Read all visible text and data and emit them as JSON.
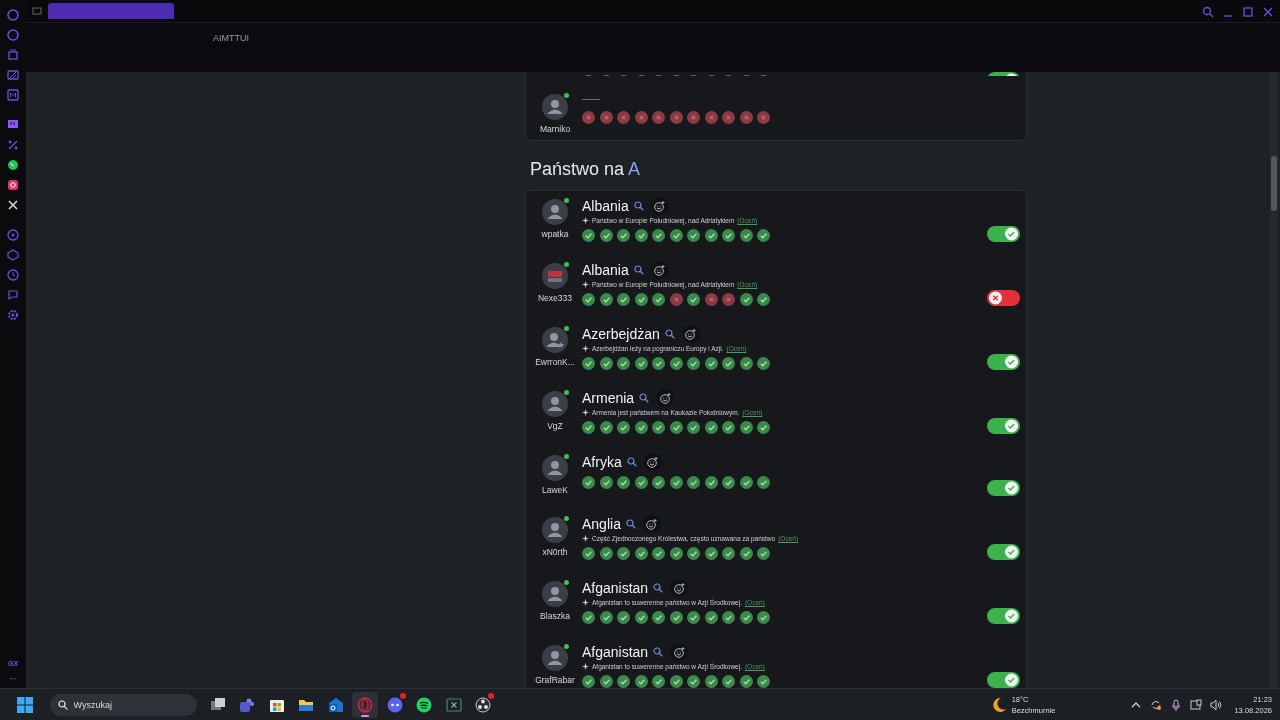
{
  "top_bar": {
    "address_text": "AIMTTUI"
  },
  "sidebar": {
    "footer_label": "GX",
    "more_label": "···"
  },
  "content": [
    {
      "kind": "card",
      "rows": [
        {
          "kind": "cut",
          "votes": [
            true,
            true,
            true,
            true,
            true,
            true,
            true,
            true,
            true,
            true,
            true
          ],
          "accepted": true
        },
        {
          "kind": "answer",
          "player": "Marniko",
          "online": true,
          "avatar": {
            "kind": "default"
          },
          "answer": "——",
          "votes": [
            false,
            false,
            false,
            false,
            false,
            false,
            false,
            false,
            false,
            false,
            false
          ]
        }
      ]
    },
    {
      "kind": "heading",
      "text": "Państwo na",
      "letter": "A"
    },
    {
      "kind": "card",
      "rows": [
        {
          "kind": "answer",
          "player": "wpatka",
          "online": true,
          "avatar": {
            "kind": "default"
          },
          "answer": "Albania",
          "description": "Państwo w Europie Południowej, nad Adriatykiem",
          "rate_link": "(Oceń)",
          "votes": [
            true,
            true,
            true,
            true,
            true,
            true,
            true,
            true,
            true,
            true,
            true
          ],
          "accepted": true
        },
        {
          "kind": "answer",
          "player": "Nexe333",
          "online": true,
          "avatar": {
            "kind": "image"
          },
          "answer": "Albania",
          "description": "Państwo w Europie Południowej, nad Adriatykiem",
          "rate_link": "(Oceń)",
          "votes": [
            true,
            true,
            true,
            true,
            true,
            false,
            true,
            false,
            false,
            true,
            true
          ],
          "accepted": false
        },
        {
          "kind": "answer",
          "player": "EwrronK...",
          "online": true,
          "avatar": {
            "kind": "star"
          },
          "answer": "Azerbejdżan",
          "description": "Azerbejdżan leży na pograniczu Europy i Azji.",
          "rate_link": "(Oceń)",
          "votes": [
            true,
            true,
            true,
            true,
            true,
            true,
            true,
            true,
            true,
            true,
            true
          ],
          "accepted": true
        },
        {
          "kind": "answer",
          "player": "VgZ",
          "online": true,
          "avatar": {
            "kind": "default"
          },
          "answer": "Armenia",
          "description": "Armenia jest państwem na Kaukazie Południowym.",
          "rate_link": "(Oceń)",
          "votes": [
            true,
            true,
            true,
            true,
            true,
            true,
            true,
            true,
            true,
            true,
            true
          ],
          "accepted": true
        },
        {
          "kind": "answer",
          "player": "LaweK",
          "online": true,
          "avatar": {
            "kind": "default"
          },
          "answer": "Afryka",
          "votes": [
            true,
            true,
            true,
            true,
            true,
            true,
            true,
            true,
            true,
            true,
            true
          ],
          "accepted": true
        },
        {
          "kind": "answer",
          "player": "xN0rth",
          "online": true,
          "avatar": {
            "kind": "default"
          },
          "answer": "Anglia",
          "description": "Część Zjednoczonego Królestwa, często uznawana za państwo",
          "rate_link": "(Oceń)",
          "votes": [
            true,
            true,
            true,
            true,
            true,
            true,
            true,
            true,
            true,
            true,
            true
          ],
          "accepted": true
        },
        {
          "kind": "answer",
          "player": "Blaszka",
          "online": true,
          "avatar": {
            "kind": "default"
          },
          "answer": "Afganistan",
          "description": "Afganistan to suwerenne państwo w Azji Środkowej.",
          "rate_link": "(Oceń)",
          "votes": [
            true,
            true,
            true,
            true,
            true,
            true,
            true,
            true,
            true,
            true,
            true
          ],
          "accepted": true
        },
        {
          "kind": "answer",
          "player": "GrafRabar",
          "online": true,
          "avatar": {
            "kind": "default"
          },
          "answer": "Afganistan",
          "description": "Afganistan to suwerenne państwo w Azji Środkowej.",
          "rate_link": "(Oceń)",
          "votes": [
            true,
            true,
            true,
            true,
            true,
            true,
            true,
            true,
            true,
            true,
            true
          ],
          "accepted": true
        }
      ]
    }
  ],
  "taskbar": {
    "search_placeholder": "Wyszukaj",
    "apps": [
      {
        "kind": "windows",
        "selected": false,
        "badge": false
      },
      {
        "kind": "people",
        "selected": false,
        "badge": false
      },
      {
        "kind": "bag",
        "selected": false,
        "badge": false
      },
      {
        "kind": "folder",
        "selected": false,
        "badge": false
      },
      {
        "kind": "mail",
        "selected": false,
        "badge": false
      },
      {
        "kind": "ring",
        "selected": true,
        "badge": false
      },
      {
        "kind": "chat",
        "selected": false,
        "badge": true
      },
      {
        "kind": "waves",
        "selected": false,
        "badge": false
      },
      {
        "kind": "xbox",
        "selected": false,
        "badge": false
      },
      {
        "kind": "aperture",
        "selected": false,
        "badge": true
      }
    ],
    "weather": {
      "temperature": "18°C",
      "condition": "Bezchmurnie"
    },
    "clock": {
      "time": "21:23",
      "date": "13.08.2026"
    }
  }
}
